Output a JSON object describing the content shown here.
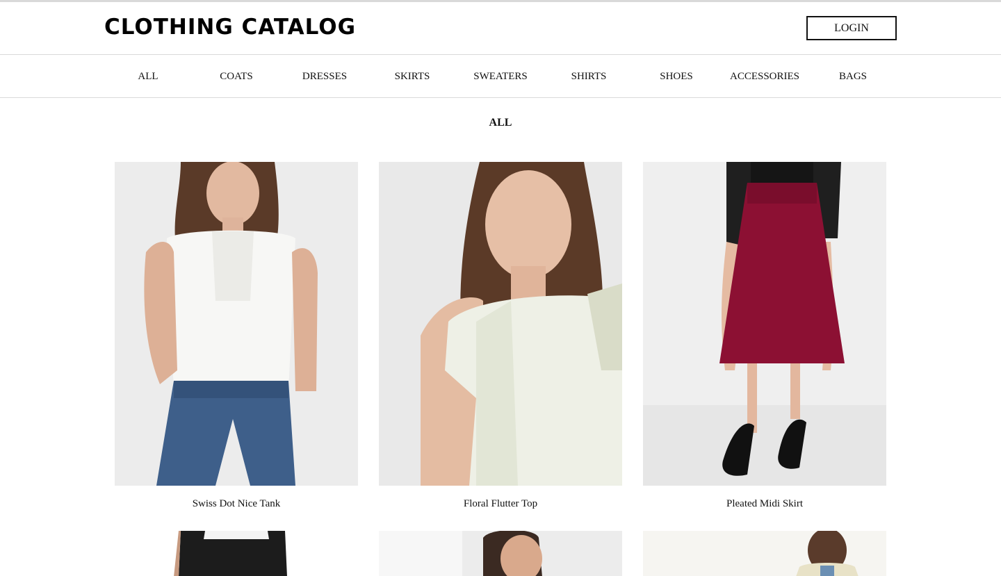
{
  "header": {
    "logo": "CLOTHING CATALOG",
    "login_label": "LOGIN"
  },
  "nav": {
    "items": [
      "ALL",
      "COATS",
      "DRESSES",
      "SKIRTS",
      "SWEATERS",
      "SHIRTS",
      "SHOES",
      "ACCESSORIES",
      "BAGS"
    ],
    "active": "ALL"
  },
  "main": {
    "section_title": "ALL",
    "products": [
      {
        "name": "Swiss Dot Nice Tank",
        "image": "woman in white sleeveless lace top and blue jeans"
      },
      {
        "name": "Floral Flutter Top",
        "image": "woman in white floral print flutter-sleeve top"
      },
      {
        "name": "Pleated Midi Skirt",
        "image": "burgundy pleated midi skirt with black jacket and heels"
      }
    ]
  },
  "colors": {
    "border": "#d9d9d9",
    "text": "#111111",
    "photo_bg": "#ececec",
    "skirt": "#8c1033"
  }
}
